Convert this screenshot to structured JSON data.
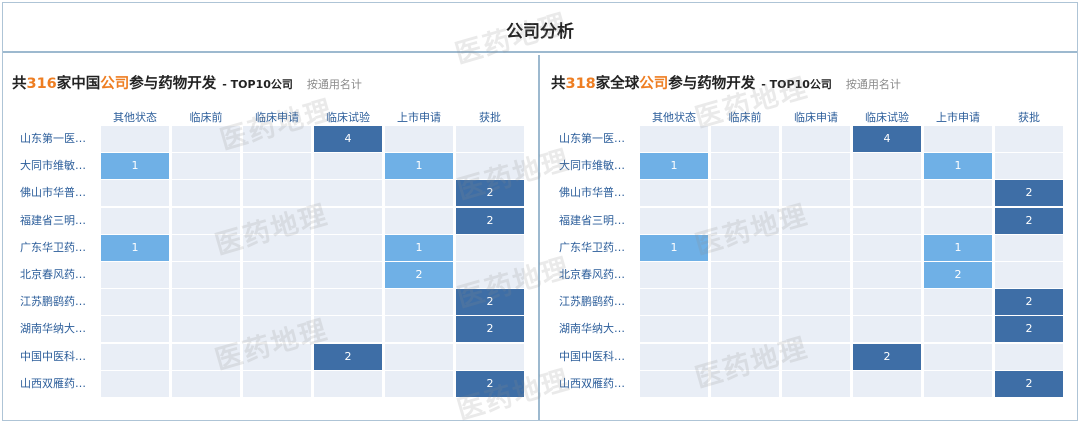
{
  "header": {
    "title": "公司分析"
  },
  "columns": [
    "其他状态",
    "临床前",
    "临床申请",
    "临床试验",
    "上市申请",
    "获批"
  ],
  "panels": [
    {
      "title_prefix": "共",
      "title_count": "316",
      "title_mid": "家中国",
      "title_highlight": "公司",
      "title_suffix": "参与药物开发",
      "title_tag": "- TOP10公司",
      "title_note": "按通用名计",
      "rows": [
        {
          "label": "山东第一医…",
          "cells": [
            "",
            "",
            "",
            "4",
            "",
            ""
          ]
        },
        {
          "label": "大同市维敏…",
          "cells": [
            "1",
            "",
            "",
            "",
            "1",
            ""
          ]
        },
        {
          "label": "佛山市华普…",
          "cells": [
            "",
            "",
            "",
            "",
            "",
            "2"
          ]
        },
        {
          "label": "福建省三明…",
          "cells": [
            "",
            "",
            "",
            "",
            "",
            "2"
          ]
        },
        {
          "label": "广东华卫药…",
          "cells": [
            "1",
            "",
            "",
            "",
            "1",
            ""
          ]
        },
        {
          "label": "北京春风药…",
          "cells": [
            "",
            "",
            "",
            "",
            "2",
            ""
          ]
        },
        {
          "label": "江苏鹏鹞药…",
          "cells": [
            "",
            "",
            "",
            "",
            "",
            "2"
          ]
        },
        {
          "label": "湖南华纳大…",
          "cells": [
            "",
            "",
            "",
            "",
            "",
            "2"
          ]
        },
        {
          "label": "中国中医科…",
          "cells": [
            "",
            "",
            "",
            "2",
            "",
            ""
          ]
        },
        {
          "label": "山西双雁药…",
          "cells": [
            "",
            "",
            "",
            "",
            "",
            "2"
          ]
        }
      ]
    },
    {
      "title_prefix": "共",
      "title_count": "318",
      "title_mid": "家全球",
      "title_highlight": "公司",
      "title_suffix": "参与药物开发",
      "title_tag": "- TOP10公司",
      "title_note": "按通用名计",
      "rows": [
        {
          "label": "山东第一医…",
          "cells": [
            "",
            "",
            "",
            "4",
            "",
            ""
          ]
        },
        {
          "label": "大同市维敏…",
          "cells": [
            "1",
            "",
            "",
            "",
            "1",
            ""
          ]
        },
        {
          "label": "佛山市华普…",
          "cells": [
            "",
            "",
            "",
            "",
            "",
            "2"
          ]
        },
        {
          "label": "福建省三明…",
          "cells": [
            "",
            "",
            "",
            "",
            "",
            "2"
          ]
        },
        {
          "label": "广东华卫药…",
          "cells": [
            "1",
            "",
            "",
            "",
            "1",
            ""
          ]
        },
        {
          "label": "北京春风药…",
          "cells": [
            "",
            "",
            "",
            "",
            "2",
            ""
          ]
        },
        {
          "label": "江苏鹏鹞药…",
          "cells": [
            "",
            "",
            "",
            "",
            "",
            "2"
          ]
        },
        {
          "label": "湖南华纳大…",
          "cells": [
            "",
            "",
            "",
            "",
            "",
            "2"
          ]
        },
        {
          "label": "中国中医科…",
          "cells": [
            "",
            "",
            "",
            "2",
            "",
            ""
          ]
        },
        {
          "label": "山西双雁药…",
          "cells": [
            "",
            "",
            "",
            "",
            "",
            "2"
          ]
        }
      ]
    }
  ],
  "colors": {
    "empty": "#e9eef6",
    "light": "#6fb0e6",
    "dark": "#3e6ea6",
    "accent": "#ee7e22"
  },
  "watermark": "医药地理"
}
